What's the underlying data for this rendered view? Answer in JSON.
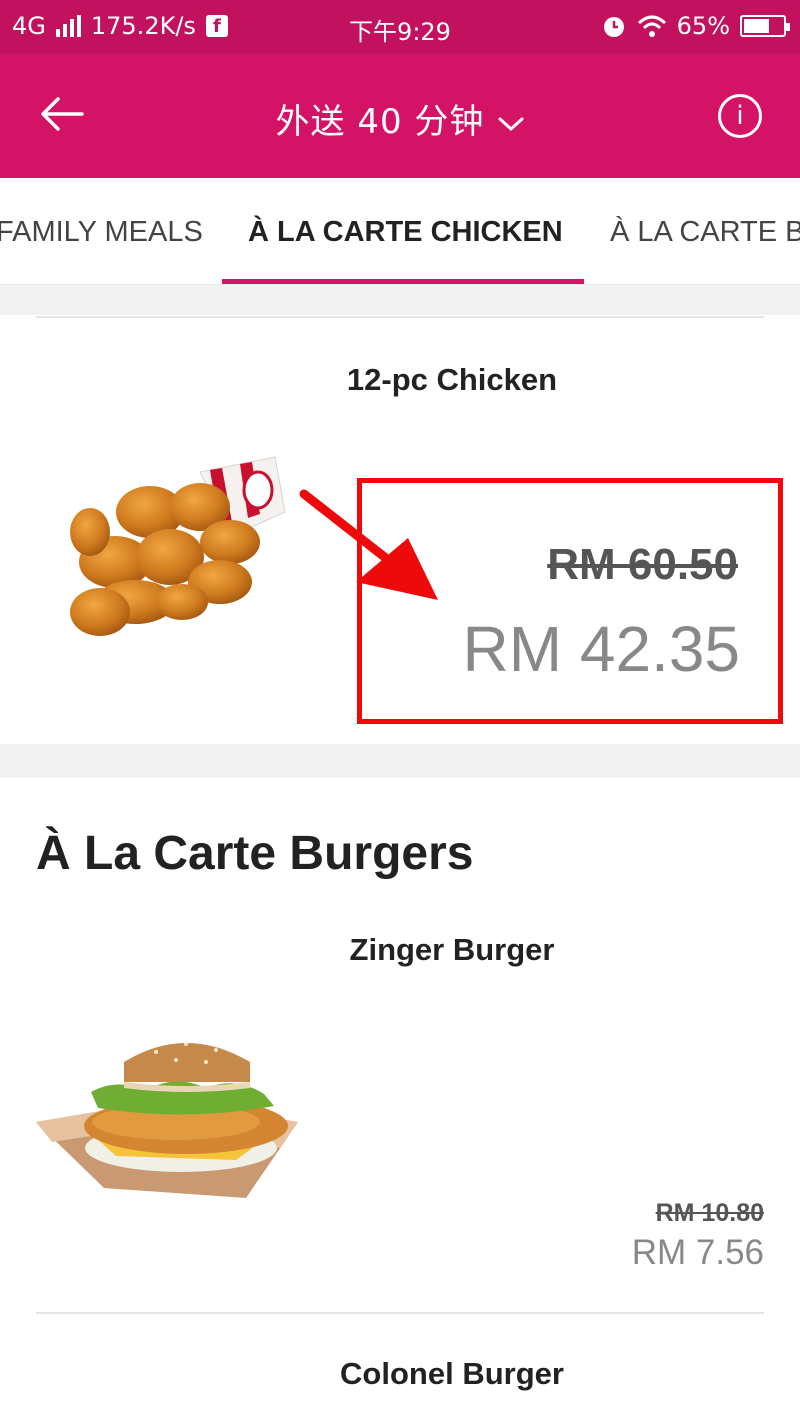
{
  "status_bar": {
    "network": "4G",
    "speed": "175.2K/s",
    "time": "下午9:29",
    "battery": "65%",
    "battery_level": 0.65
  },
  "app_bar": {
    "title": "外送 40 分钟",
    "back_icon": "arrow-left-icon",
    "info_icon": "info-icon"
  },
  "tabs": [
    {
      "label": "FAMILY MEALS",
      "active": false
    },
    {
      "label": "À LA CARTE CHICKEN",
      "active": true
    },
    {
      "label": "À LA CARTE B",
      "active": false
    }
  ],
  "items": [
    {
      "name": "12-pc Chicken",
      "old_price": "RM 60.50",
      "price": "RM 42.35"
    },
    {
      "name": "Zinger Burger",
      "old_price": "RM 10.80",
      "price": "RM 7.56"
    },
    {
      "name": "Colonel Burger"
    }
  ],
  "sections": [
    {
      "title": "À La Carte Burgers"
    }
  ],
  "colors": {
    "brand": "#d41367",
    "status_bar": "#c2125f",
    "highlight": "#ee0a0a"
  }
}
